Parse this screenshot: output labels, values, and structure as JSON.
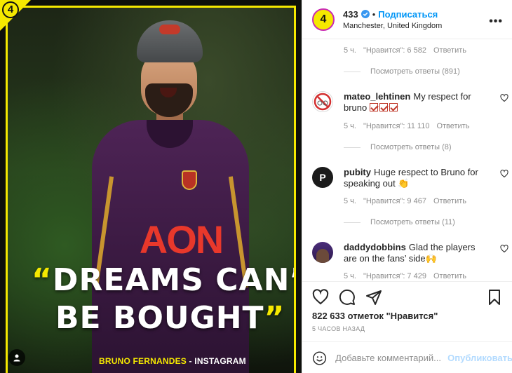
{
  "post_image": {
    "corner_badge": "4",
    "jersey_sponsor": "AON",
    "quote_open": "“",
    "quote_line1": "DREAMS CAN’T",
    "quote_line2": "BE BOUGHT",
    "quote_close": "”",
    "attribution_name": "BRUNO FERNANDES",
    "attribution_source": " - INSTAGRAM",
    "accent_color": "#f5e800"
  },
  "header": {
    "avatar_text": "4",
    "username": "433",
    "separator": "•",
    "follow_label": "Подписаться",
    "location": "Manchester, United Kingdom",
    "more_label": "•••"
  },
  "comments": [
    {
      "meta_only": true,
      "time": "5 ч.",
      "likes": "\"Нравится\": 6 582",
      "reply": "Ответить",
      "view_replies": "Посмотреть ответы (891)"
    },
    {
      "username": "mateo_lehtinen",
      "text": "My respect for bruno",
      "time": "5 ч.",
      "likes": "\"Нравится\": 11 110",
      "reply": "Ответить",
      "view_replies": "Посмотреть ответы (8)"
    },
    {
      "username": "pubity",
      "text": "Huge respect to Bruno for speaking out 👏",
      "avatar_text": "P",
      "time": "5 ч.",
      "likes": "\"Нравится\": 9 467",
      "reply": "Ответить",
      "view_replies": "Посмотреть ответы (11)"
    },
    {
      "username": "daddydobbins",
      "text": "Glad the players are on the fans’ side🙌",
      "time": "5 ч.",
      "likes": "\"Нравится\": 7 429",
      "reply": "Ответить"
    }
  ],
  "actions": {
    "likes_text": "822 633 отметок \"Нравится\"",
    "time_ago": "5 часов назад"
  },
  "add_comment": {
    "placeholder": "Добавьте комментарий...",
    "publish_label": "Опубликовать"
  },
  "colors": {
    "link": "#0095f6",
    "publish_disabled": "#b3dbff",
    "muted": "#8e8e8e"
  }
}
